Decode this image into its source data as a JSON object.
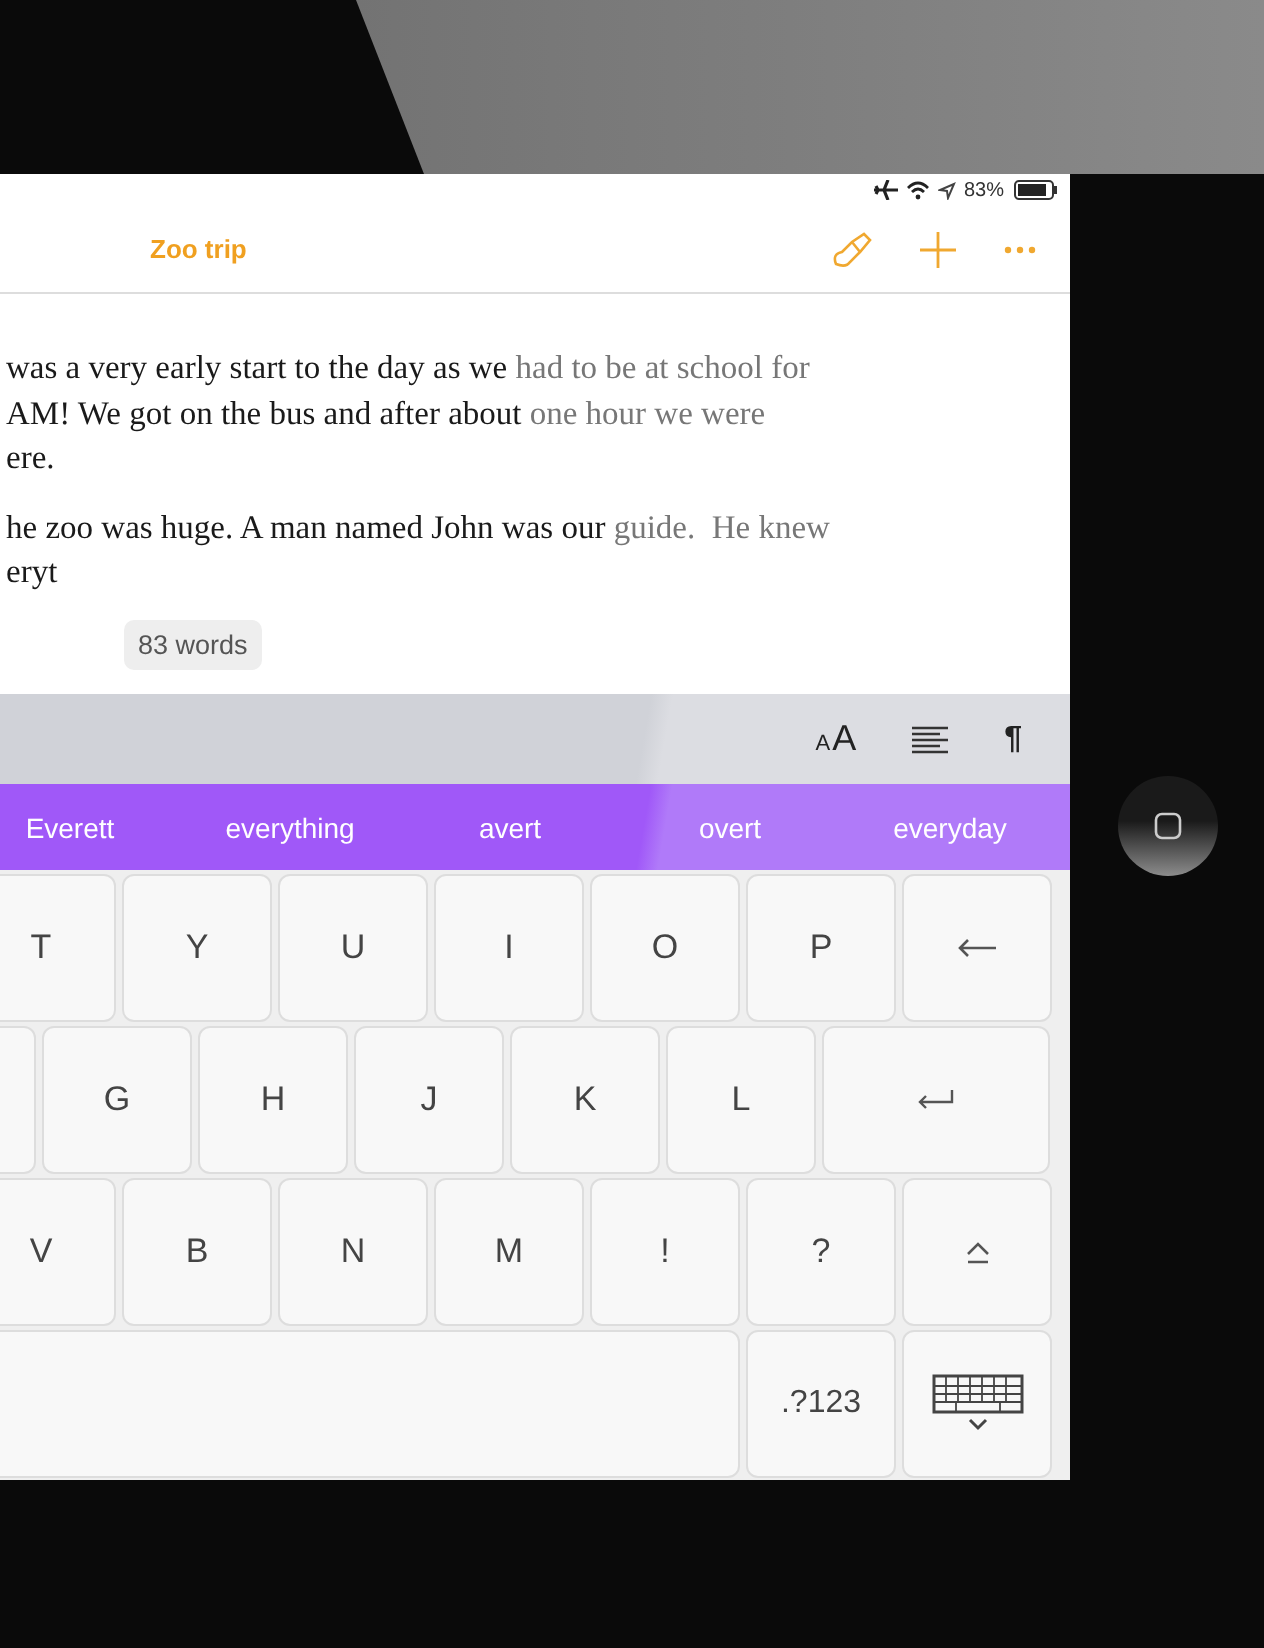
{
  "status_bar": {
    "battery": "83%"
  },
  "nav_bar": {
    "title": "Zoo trip"
  },
  "document": {
    "paragraphs": [
      {
        "lines": [
          [
            {
              "text": "was a very early start to the day as we ",
              "dimmed": false
            },
            {
              "text": "had to be at school for",
              "dimmed": true
            }
          ],
          [
            {
              "text": "AM! We got on the bus and after about ",
              "dimmed": false
            },
            {
              "text": "one hour we were",
              "dimmed": true
            }
          ],
          [
            {
              "text": "ere.",
              "dimmed": false
            }
          ]
        ]
      },
      {
        "lines": [
          [
            {
              "text": "he zoo was huge. A man named John was our ",
              "dimmed": false
            },
            {
              "text": "guide.  He knew",
              "dimmed": true
            }
          ],
          [
            {
              "text": "eryt",
              "dimmed": false
            }
          ]
        ]
      }
    ],
    "word_count": "83 words"
  },
  "format_toolbar": {
    "text_size_small": "A",
    "text_size_large": "A",
    "paragraph_mark": "¶"
  },
  "suggestions": [
    "Everett",
    "everything",
    "avert",
    "overt",
    "everyday"
  ],
  "keyboard": {
    "rows": [
      [
        {
          "kind": "letter",
          "label": "T"
        },
        {
          "kind": "letter",
          "label": "Y"
        },
        {
          "kind": "letter",
          "label": "U"
        },
        {
          "kind": "letter",
          "label": "I"
        },
        {
          "kind": "letter",
          "label": "O"
        },
        {
          "kind": "letter",
          "label": "P"
        },
        {
          "kind": "backspace"
        }
      ],
      [
        {
          "kind": "letter"
        },
        {
          "kind": "letter",
          "label": "G"
        },
        {
          "kind": "letter",
          "label": "H"
        },
        {
          "kind": "letter",
          "label": "J"
        },
        {
          "kind": "letter",
          "label": "K"
        },
        {
          "kind": "letter",
          "label": "L"
        },
        {
          "kind": "return"
        }
      ],
      [
        {
          "kind": "letter",
          "label": "V"
        },
        {
          "kind": "letter",
          "label": "B"
        },
        {
          "kind": "letter",
          "label": "N"
        },
        {
          "kind": "letter",
          "label": "M"
        },
        {
          "kind": "letter",
          "label": "!"
        },
        {
          "kind": "letter",
          "label": "?"
        },
        {
          "kind": "shift"
        }
      ]
    ],
    "bottom_row": [
      {
        "kind": "space"
      },
      {
        "kind": "symbols",
        "label": ".?123"
      },
      {
        "kind": "hide"
      }
    ]
  }
}
